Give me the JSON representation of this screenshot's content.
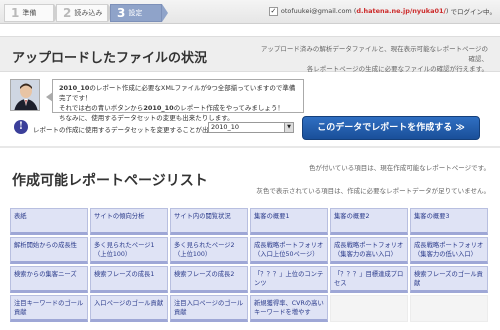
{
  "steps": [
    {
      "num": "1",
      "label": "準備"
    },
    {
      "num": "2",
      "label": "読み込み"
    },
    {
      "num": "3",
      "label": "設定"
    }
  ],
  "user": {
    "email": "otofuukei@gmail.com",
    "domain": "d.hatena.ne.jp/nyuka01/",
    "logged_in": "でログイン中。"
  },
  "uploaded": {
    "title": "アップロードしたファイルの状況",
    "desc_line1": "アップロード済みの解析データファイルと、現在表示可能なレポートページの確認、",
    "desc_line2": "各レポートページの生成に必要なファイルの確認が行えます。"
  },
  "message": {
    "line1_dataset": "2010_10",
    "line1_rest": "のレポート作成に必要なXMLファイルが9つ全部揃っていますので準備完了です！",
    "line2_prefix": "それでは右の青いボタンから",
    "line2_dataset": "2010_10",
    "line2_rest": "のレポート作成をやってみましょう！",
    "line3": "ちなみに、使用するデータセットの変更も出来たりします。"
  },
  "dataset": {
    "label": "レポートの作成に使用するデータセットを変更することが出来ます。",
    "selected": "2010_10",
    "button": "このデータでレポートを作成する ≫"
  },
  "report_list": {
    "title": "作成可能レポートページリスト",
    "note1": "色が付いている項目は、現在作成可能なレポートページです。",
    "note2": "灰色で表示されている項目は、作成に必要なレポートデータが足りていません。",
    "items": [
      {
        "label": "表紙",
        "available": true
      },
      {
        "label": "サイトの傾向分析",
        "available": true
      },
      {
        "label": "サイト内の閲覧状況",
        "available": true
      },
      {
        "label": "集客の概要1",
        "available": true
      },
      {
        "label": "集客の概要2",
        "available": true
      },
      {
        "label": "集客の概要3",
        "available": true
      },
      {
        "label": "解析開始からの成長性",
        "available": true
      },
      {
        "label": "多く見られたページ1（上位100）",
        "available": true
      },
      {
        "label": "多く見られたページ2（上位100）",
        "available": true
      },
      {
        "label": "成長戦略ポートフォリオ（入口上位50ページ）",
        "available": true
      },
      {
        "label": "成長戦略ポートフォリオ（集客力の高い入口）",
        "available": true
      },
      {
        "label": "成長戦略ポートフォリオ（集客力の低い入口）",
        "available": true
      },
      {
        "label": "検索からの集客ニーズ",
        "available": true
      },
      {
        "label": "検索フレーズの成長1",
        "available": true
      },
      {
        "label": "検索フレーズの成長2",
        "available": true
      },
      {
        "label": "「？？？」上位のコンテンツ",
        "available": true
      },
      {
        "label": "「？？？」目標達成プロセス",
        "available": true
      },
      {
        "label": "検索フレーズのゴール貢献",
        "available": true
      },
      {
        "label": "注目キーワードのゴール貢献",
        "available": true
      },
      {
        "label": "入口ページのゴール貢献",
        "available": true
      },
      {
        "label": "注目入口ページのゴール貢献",
        "available": true
      },
      {
        "label": "新規獲得率、CVRの高いキーワードを増やす",
        "available": true
      },
      {
        "label": "",
        "available": false
      },
      {
        "label": "",
        "available": false
      }
    ]
  }
}
